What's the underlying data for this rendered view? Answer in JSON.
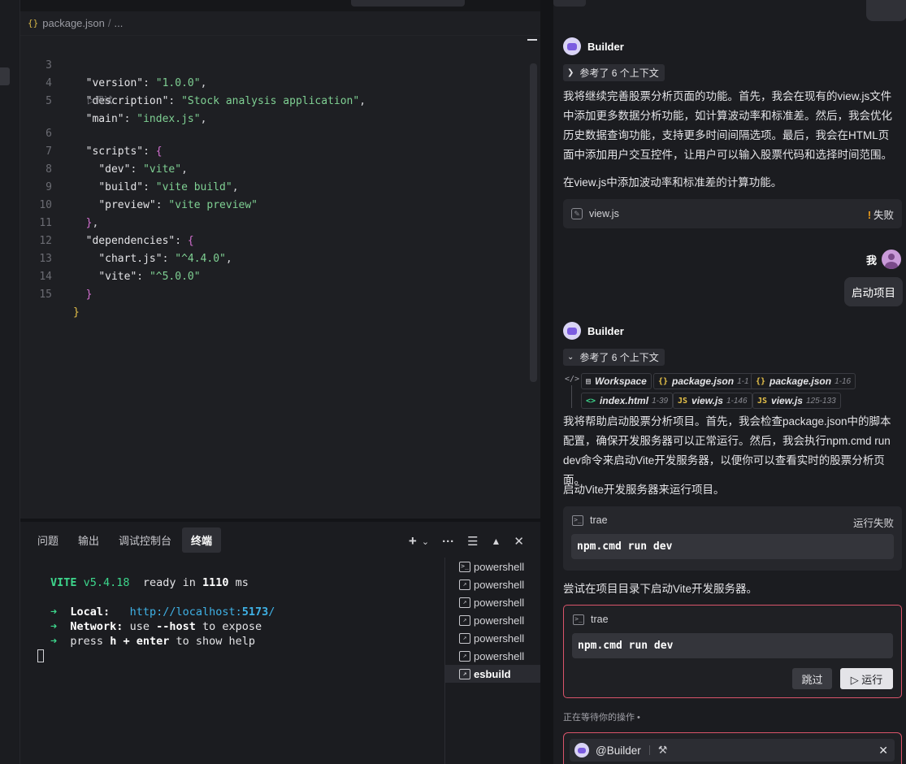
{
  "editor": {
    "breadcrumb": {
      "file": "package.json",
      "sep": "/",
      "more": "..."
    },
    "codelens": "▷调试",
    "lines": [
      {
        "n": "3"
      },
      {
        "n": "4"
      },
      {
        "n": "5"
      },
      {
        "n": "6"
      },
      {
        "n": "7"
      },
      {
        "n": "8"
      },
      {
        "n": "9"
      },
      {
        "n": "10"
      },
      {
        "n": "11"
      },
      {
        "n": "12"
      },
      {
        "n": "13"
      },
      {
        "n": "14"
      },
      {
        "n": "15"
      }
    ],
    "tokens": {
      "version_key": "\"version\"",
      "version_val": "\"1.0.0\"",
      "description_key": "\"description\"",
      "description_val": "\"Stock analysis application\"",
      "main_key": "\"main\"",
      "main_val": "\"index.js\"",
      "scripts_key": "\"scripts\"",
      "dev_key": "\"dev\"",
      "dev_val": "\"vite\"",
      "build_key": "\"build\"",
      "build_val": "\"vite build\"",
      "preview_key": "\"preview\"",
      "preview_val": "\"vite preview\"",
      "deps_key": "\"dependencies\"",
      "chartjs_key": "\"chart.js\"",
      "chartjs_val": "\"^4.4.0\"",
      "vite_key": "\"vite\"",
      "vite_val": "\"^5.0.0\""
    }
  },
  "panel": {
    "tabs": [
      "问题",
      "输出",
      "调试控制台",
      "终端"
    ],
    "active_tab": "终端",
    "terminal": {
      "vite_name": "VITE",
      "vite_version": "v5.4.18",
      "ready_prefix": "ready in",
      "ready_time": "1110",
      "ready_unit": "ms",
      "arrow": "➜",
      "local_label": "Local:",
      "local_url_prefix": "http://localhost:",
      "local_port": "5173",
      "local_url_suffix": "/",
      "network_label": "Network:",
      "network_text_1": "use",
      "network_flag": "--host",
      "network_text_2": "to expose",
      "help_text_1": "press",
      "help_key": "h + enter",
      "help_text_2": "to show help"
    },
    "shells": [
      "powershell",
      "powershell",
      "powershell",
      "powershell",
      "powershell",
      "powershell",
      "esbuild"
    ],
    "active_shell": "esbuild"
  },
  "chat": {
    "assistant_name": "Builder",
    "context_label_1": "参考了 6 个上下文",
    "message_1": "我将继续完善股票分析页面的功能。首先，我会在现有的view.js文件中添加更多数据分析功能，如计算波动率和标准差。然后，我会优化历史数据查询功能，支持更多时间间隔选项。最后，我会在HTML页面中添加用户交互控件，让用户可以输入股票代码和选择时间范围。",
    "message_2": "在view.js中添加波动率和标准差的计算功能。",
    "file_card": {
      "name": "view.js",
      "status": "失败"
    },
    "user_name": "我",
    "user_message": "启动项目",
    "context_label_2": "参考了 6 个上下文",
    "context_chips": [
      {
        "icon": "workspace-icon",
        "name": "Workspace",
        "range": ""
      },
      {
        "icon": "json-icon",
        "name": "package.json",
        "range": "1-1"
      },
      {
        "icon": "json-icon",
        "name": "package.json",
        "range": "1-16"
      },
      {
        "icon": "html-icon",
        "name": "index.html",
        "range": "1-39"
      },
      {
        "icon": "js-icon",
        "name": "view.js",
        "range": "1-146"
      },
      {
        "icon": "js-icon",
        "name": "view.js",
        "range": "125-133"
      }
    ],
    "message_3": "我将帮助启动股票分析项目。首先，我会检查package.json中的脚本配置，确保开发服务器可以正常运行。然后，我会执行npm.cmd run dev命令来启动Vite开发服务器，以便你可以查看实时的股票分析页面。",
    "message_4": "启动Vite开发服务器来运行项目。",
    "command_card_1": {
      "tool": "trae",
      "status": "运行失败",
      "command": "npm.cmd run dev"
    },
    "message_5": "尝试在项目目录下启动Vite开发服务器。",
    "command_card_2": {
      "tool": "trae",
      "command": "npm.cmd run dev",
      "skip_label": "跳过",
      "run_label": "▷ 运行"
    },
    "waiting_text": "正在等待你的操作 •",
    "input": {
      "mention": "@Builder"
    }
  },
  "colors": {
    "accent_green": "#3dd68c",
    "url_blue": "#3fb2e6",
    "json_string": "#7fd093",
    "brace_yellow": "#e6c14a",
    "brace_magenta": "#d36fd0",
    "pending_border": "#d9546a",
    "warning": "#f4a11a"
  }
}
